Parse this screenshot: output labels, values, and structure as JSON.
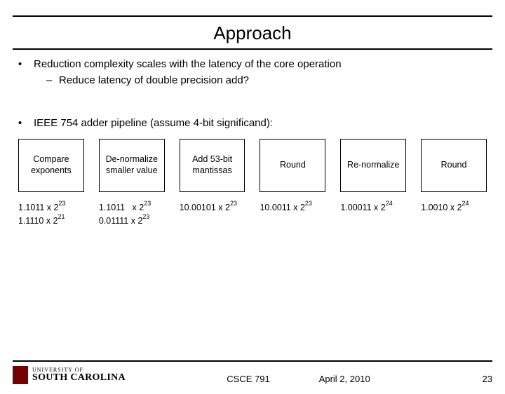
{
  "title": "Approach",
  "bullet1": "Reduction complexity scales with the latency of the core operation",
  "bullet1_sub": "Reduce  latency of double precision add?",
  "bullet2": "IEEE 754 adder pipeline (assume 4-bit significand):",
  "stages": {
    "s0": "Compare exponents",
    "s1": "De-normalize smaller value",
    "s2": "Add 53-bit mantissas",
    "s3": "Round",
    "s4": "Re-normalize",
    "s5": "Round"
  },
  "examples": {
    "c0a_m": "1.1011",
    "c0a_b": "2",
    "c0a_e": "23",
    "c0b_m": "1.1110",
    "c0b_b": "2",
    "c0b_e": "21",
    "c1a_m": "1.1011",
    "c1a_b": "2",
    "c1a_e": "23",
    "c1b_m": "0.01111",
    "c1b_b": "2",
    "c1b_e": "23",
    "c2_m": "10.00101",
    "c2_b": "2",
    "c2_e": "23",
    "c3_m": "10.0011",
    "c3_b": "2",
    "c3_e": "23",
    "c4_m": "1.00011",
    "c4_b": "2",
    "c4_e": "24",
    "c5_m": "1.0010",
    "c5_b": "2",
    "c5_e": "24"
  },
  "footer": {
    "logo_small": "UNIVERSITY OF",
    "logo_big": "SOUTH CAROLINA",
    "course": "CSCE 791",
    "date": "April 2, 2010",
    "page": "23"
  }
}
